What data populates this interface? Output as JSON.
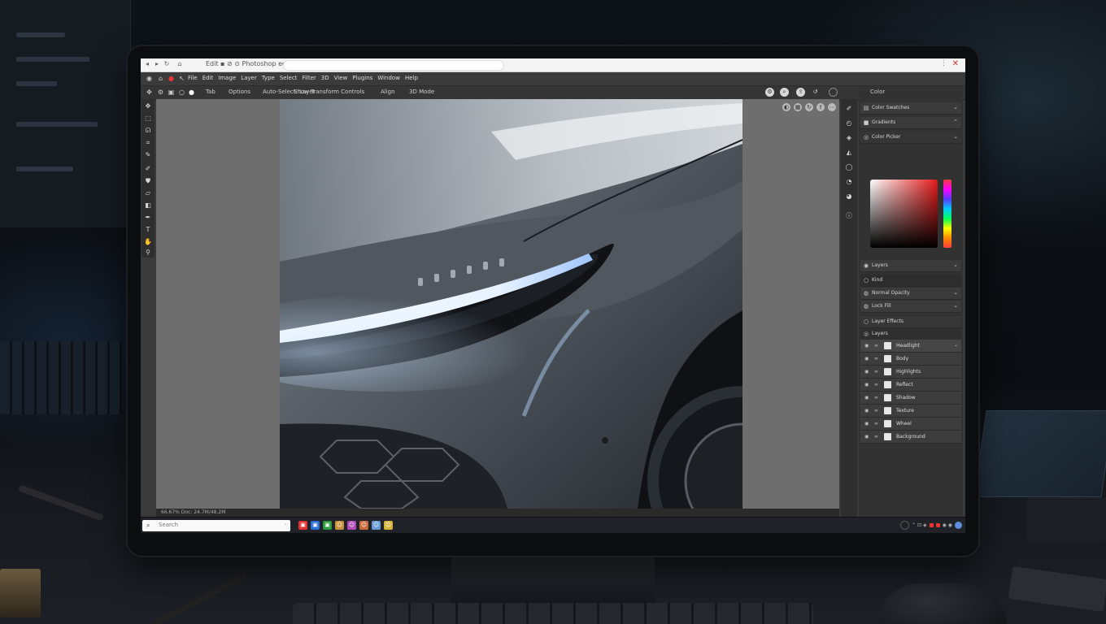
{
  "browser": {
    "title": "Edit ▪ ⊘ ⊙ Photoshop editor",
    "close_glyph": "✕",
    "dots_glyph": "⋮"
  },
  "menu": {
    "items": [
      "File",
      "Edit",
      "Image",
      "Layer",
      "Type",
      "Select",
      "Filter",
      "3D",
      "View",
      "Plugins",
      "Window",
      "Help"
    ]
  },
  "options": {
    "tool_label": "Tab",
    "mode_label": "Options",
    "auto_select": "Auto-Select: Layer",
    "transform": "Show Transform Controls",
    "align": "Align",
    "distribute": "3D Mode"
  },
  "panels": {
    "header": "Color",
    "row1": "Color Swatches",
    "row2": "Gradients",
    "row3": "Color Picker",
    "layers_title": "Layers",
    "layers_rows": [
      "Kind",
      "Normal   Opacity",
      "Lock   Fill"
    ],
    "layer_group": "Layer Effects",
    "layer_tab": "Layers",
    "layers": [
      "Headlight",
      "Body",
      "Highlights",
      "Reflect",
      "Shadow",
      "Texture",
      "Wheel",
      "Background"
    ]
  },
  "canvas_status": "66.67%   Doc: 24.7M/48.2M",
  "taskbar": {
    "search_placeholder": "Search"
  },
  "colors": {
    "accent_red": "#e51a1a",
    "panel_bg": "#323232",
    "canvas_bg": "#6e6e6e"
  },
  "icons": [
    "move-icon",
    "marquee-icon",
    "lasso-icon",
    "crop-icon",
    "eyedropper-icon",
    "brush-icon",
    "stamp-icon",
    "eraser-icon",
    "gradient-icon",
    "pen-icon",
    "type-icon",
    "hand-icon",
    "zoom-icon"
  ]
}
